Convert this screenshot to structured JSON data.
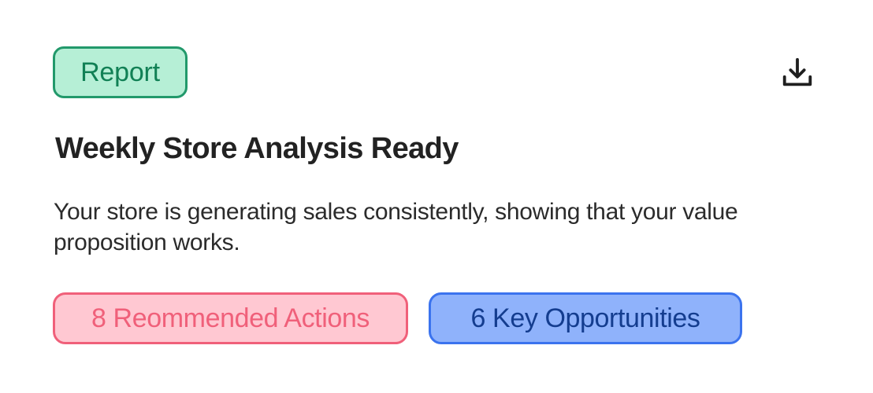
{
  "card": {
    "badge_label": "Report",
    "title": "Weekly Store Analysis Ready",
    "description": "Your store is generating sales consistently, showing that your value proposition works.",
    "download_icon": "download-icon",
    "actions_label": "8 Reommended Actions",
    "opportunities_label": "6 Key Opportunities"
  },
  "colors": {
    "report_badge_bg": "#b6efd6",
    "report_badge_border": "#22996b",
    "report_badge_text": "#118055",
    "actions_bg": "#ffc8d2",
    "actions_border": "#f0607a",
    "opportunities_bg": "#8fb2fb",
    "opportunities_border": "#3b73ee",
    "opportunities_text": "#143d8f"
  }
}
